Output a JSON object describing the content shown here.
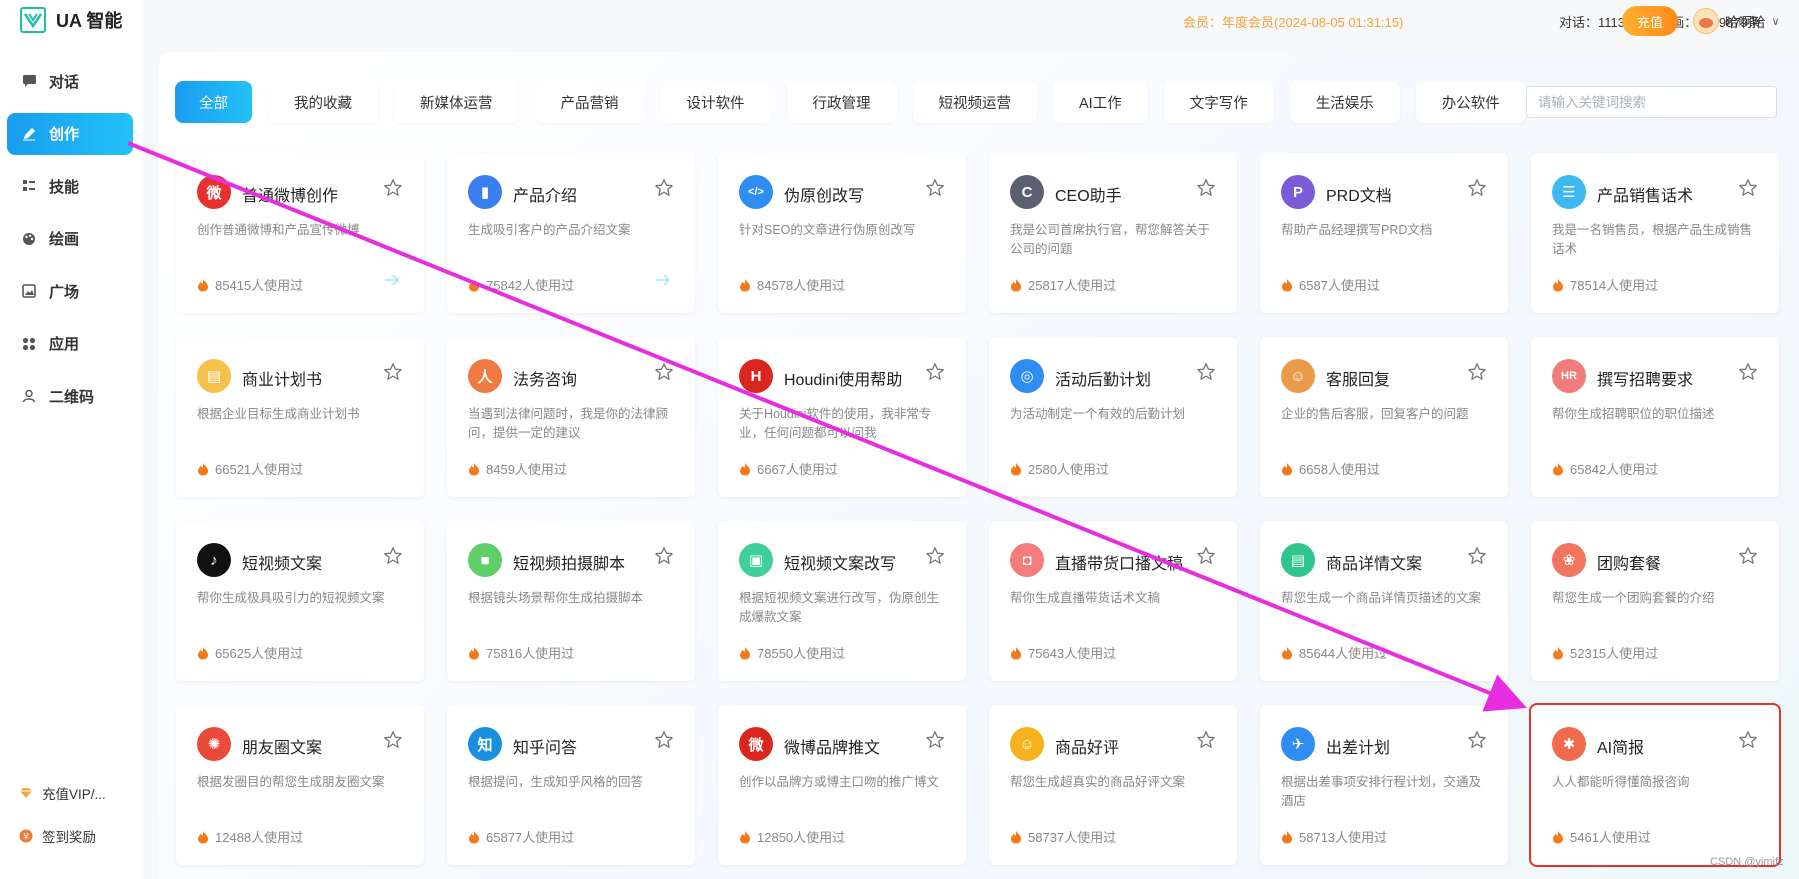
{
  "app": {
    "brand_name": "UA 智能"
  },
  "sidebar": {
    "items": [
      {
        "label": "对话",
        "icon": "chat-icon",
        "active": false
      },
      {
        "label": "创作",
        "icon": "pen-icon",
        "active": true
      },
      {
        "label": "技能",
        "icon": "grid-list-icon",
        "active": false
      },
      {
        "label": "绘画",
        "icon": "palette-icon",
        "active": false
      },
      {
        "label": "广场",
        "icon": "image-icon",
        "active": false
      },
      {
        "label": "应用",
        "icon": "apps-icon",
        "active": false
      },
      {
        "label": "二维码",
        "icon": "user-icon",
        "active": false
      }
    ],
    "bottom": [
      {
        "label": "充值VIP/...",
        "icon": "diamond-icon"
      },
      {
        "label": "签到奖励",
        "icon": "gift-icon"
      }
    ]
  },
  "topbar": {
    "vip_info": "会员：年度会员(2024-08-05 01:31:15)",
    "quota": "对话：11136条；绘画：9999879条",
    "recharge_label": "充值",
    "username": "哈啊哈"
  },
  "tabs": [
    "全部",
    "我的收藏",
    "新媒体运营",
    "产品营销",
    "设计软件",
    "行政管理",
    "短视频运营",
    "AI工作",
    "文字写作",
    "生活娱乐",
    "办公软件"
  ],
  "search": {
    "placeholder": "请输入关键词搜索",
    "value": ""
  },
  "cards": [
    {
      "title": "普通微博创作",
      "desc": "创作普通微博和产品宣传微博",
      "usage": "85415人使用过",
      "icon": "weibo-icon",
      "color": "#e6312e",
      "glyph": "微"
    },
    {
      "title": "产品介绍",
      "desc": "生成吸引客户的产品介绍文案",
      "usage": "75842人使用过",
      "icon": "book-icon",
      "color": "#3a7ff0",
      "glyph": "▮"
    },
    {
      "title": "伪原创改写",
      "desc": "针对SEO的文章进行伪原创改写",
      "usage": "84578人使用过",
      "icon": "code-icon",
      "color": "#2f8cf0",
      "glyph": "</>"
    },
    {
      "title": "CEO助手",
      "desc": "我是公司首席执行官，帮您解答关于公司的问题",
      "usage": "25817人使用过",
      "icon": "ceo-avatar-icon",
      "color": "#5a6070",
      "glyph": "C"
    },
    {
      "title": "PRD文档",
      "desc": "帮助产品经理撰写PRD文档",
      "usage": "6587人使用过",
      "icon": "pm-avatar-icon",
      "color": "#7b5bd6",
      "glyph": "P"
    },
    {
      "title": "产品销售话术",
      "desc": "我是一名销售员，根据产品生成销售话术",
      "usage": "78514人使用过",
      "icon": "message-icon",
      "color": "#3db8f0",
      "glyph": "☰"
    },
    {
      "title": "商业计划书",
      "desc": "根据企业目标生成商业计划书",
      "usage": "66521人使用过",
      "icon": "notebook-icon",
      "color": "#f5c14a",
      "glyph": "▤"
    },
    {
      "title": "法务咨询",
      "desc": "当遇到法律问题时，我是你的法律顾问，提供一定的建议",
      "usage": "8459人使用过",
      "icon": "lawyer-icon",
      "color": "#f07a40",
      "glyph": "人"
    },
    {
      "title": "Houdini使用帮助",
      "desc": "关于Houdini软件的使用，我非常专业，任何问题都可以问我",
      "usage": "6667人使用过",
      "icon": "houdini-logo-icon",
      "color": "#d9261c",
      "glyph": "H"
    },
    {
      "title": "活动后勤计划",
      "desc": "为活动制定一个有效的后勤计划",
      "usage": "2580人使用过",
      "icon": "target-icon",
      "color": "#2f8cf0",
      "glyph": "◎"
    },
    {
      "title": "客服回复",
      "desc": "企业的售后客服，回复客户的问题",
      "usage": "6658人使用过",
      "icon": "support-avatar-icon",
      "color": "#e99b4a",
      "glyph": "☺"
    },
    {
      "title": "撰写招聘要求",
      "desc": "帮你生成招聘职位的职位描述",
      "usage": "65842人使用过",
      "icon": "hr-icon",
      "color": "#f07c7c",
      "glyph": "HR"
    },
    {
      "title": "短视频文案",
      "desc": "帮你生成极具吸引力的短视频文案",
      "usage": "65625人使用过",
      "icon": "tiktok-icon",
      "color": "#111111",
      "glyph": "♪"
    },
    {
      "title": "短视频拍摄脚本",
      "desc": "根据镜头场景帮你生成拍摄脚本",
      "usage": "75816人使用过",
      "icon": "camera-icon",
      "color": "#5fcf6a",
      "glyph": "■"
    },
    {
      "title": "短视频文案改写",
      "desc": "根据短视频文案进行改写，伪原创生成爆款文案",
      "usage": "78550人使用过",
      "icon": "clipboard-icon",
      "color": "#3fcf9a",
      "glyph": "▣"
    },
    {
      "title": "直播带货口播文稿",
      "desc": "帮你生成直播带货话术文稿",
      "usage": "75643人使用过",
      "icon": "shopping-bag-icon",
      "color": "#f47c7c",
      "glyph": "◘"
    },
    {
      "title": "商品详情文案",
      "desc": "帮您生成一个商品详情页描述的文案",
      "usage": "85644人使用过",
      "icon": "document-icon",
      "color": "#2fc68a",
      "glyph": "▤"
    },
    {
      "title": "团购套餐",
      "desc": "帮您生成一个团购套餐的介绍",
      "usage": "52315人使用过",
      "icon": "group-icon",
      "color": "#f2755e",
      "glyph": "❀"
    },
    {
      "title": "朋友圈文案",
      "desc": "根据发圈目的帮您生成朋友圈文案",
      "usage": "12488人使用过",
      "icon": "aperture-icon",
      "color": "#e94a3a",
      "glyph": "✺"
    },
    {
      "title": "知乎问答",
      "desc": "根据提问，生成知乎风格的回答",
      "usage": "65877人使用过",
      "icon": "zhihu-icon",
      "color": "#1a8fe0",
      "glyph": "知"
    },
    {
      "title": "微博品牌推文",
      "desc": "创作以品牌方或博主口吻的推广博文",
      "usage": "12850人使用过",
      "icon": "weibo-icon",
      "color": "#d9261c",
      "glyph": "微"
    },
    {
      "title": "商品好评",
      "desc": "帮您生成超真实的商品好评文案",
      "usage": "58737人使用过",
      "icon": "smile-icon",
      "color": "#f5b21c",
      "glyph": "☺"
    },
    {
      "title": "出差计划",
      "desc": "根据出差事项安排行程计划，交通及酒店",
      "usage": "58713人使用过",
      "icon": "plane-icon",
      "color": "#2f8cf0",
      "glyph": "✈"
    },
    {
      "title": "AI简报",
      "desc": "人人都能听得懂简报咨询",
      "usage": "5461人使用过",
      "icon": "brain-icon",
      "color": "#ef6a4a",
      "glyph": "✱"
    }
  ],
  "watermark": "CSDN @yimifz"
}
